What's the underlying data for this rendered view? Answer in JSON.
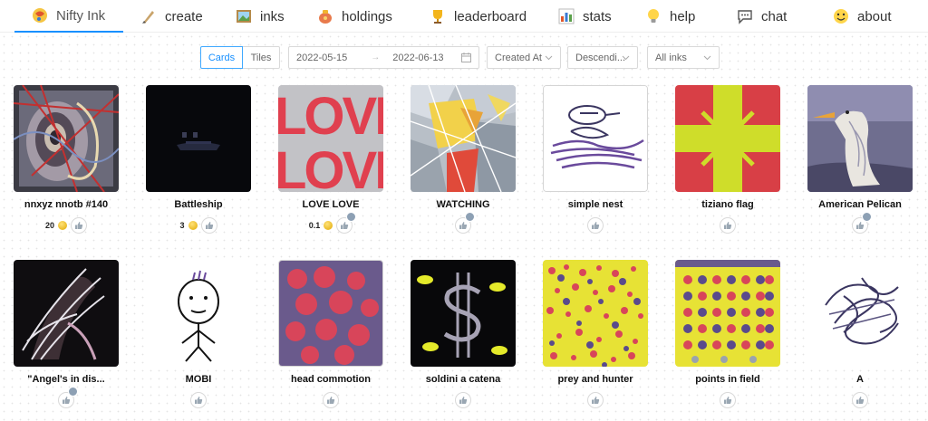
{
  "nav": {
    "items": [
      {
        "label": "Nifty Ink",
        "icon": "nifty-ink-logo-icon",
        "active": true
      },
      {
        "label": "create",
        "icon": "paintbrush-icon"
      },
      {
        "label": "inks",
        "icon": "framed-picture-icon"
      },
      {
        "label": "holdings",
        "icon": "purse-icon"
      },
      {
        "label": "leaderboard",
        "icon": "trophy-icon"
      },
      {
        "label": "stats",
        "icon": "bar-chart-icon"
      },
      {
        "label": "help",
        "icon": "lightbulb-icon"
      },
      {
        "label": "chat",
        "icon": "speech-bubble-icon"
      },
      {
        "label": "about",
        "icon": "smiley-icon"
      }
    ]
  },
  "filters": {
    "view_cards": "Cards",
    "view_tiles": "Tiles",
    "date_from": "2022-05-15",
    "date_arrow": "→",
    "date_to": "2022-06-13",
    "sort_field": "Created At",
    "sort_order": "Descendi...",
    "ink_filter": "All inks"
  },
  "inks": [
    {
      "title": "nnxyz nnotb #140",
      "price": "20"
    },
    {
      "title": "Battleship",
      "price": "3"
    },
    {
      "title": "LOVE LOVE",
      "price": "0.1"
    },
    {
      "title": "WATCHING",
      "price": ""
    },
    {
      "title": "simple nest",
      "price": ""
    },
    {
      "title": "tiziano flag",
      "price": ""
    },
    {
      "title": "American Pelican",
      "price": ""
    },
    {
      "title": "\"Angel's in dis...",
      "price": ""
    },
    {
      "title": "MOBI",
      "price": ""
    },
    {
      "title": "head commotion",
      "price": ""
    },
    {
      "title": "soldini a catena",
      "price": ""
    },
    {
      "title": "prey and hunter",
      "price": ""
    },
    {
      "title": "points in field",
      "price": ""
    },
    {
      "title": "A",
      "price": ""
    }
  ],
  "art": {
    "love_text": "LOVE"
  },
  "colors": {
    "accent": "#1890ff",
    "coin": "#e0a800"
  }
}
